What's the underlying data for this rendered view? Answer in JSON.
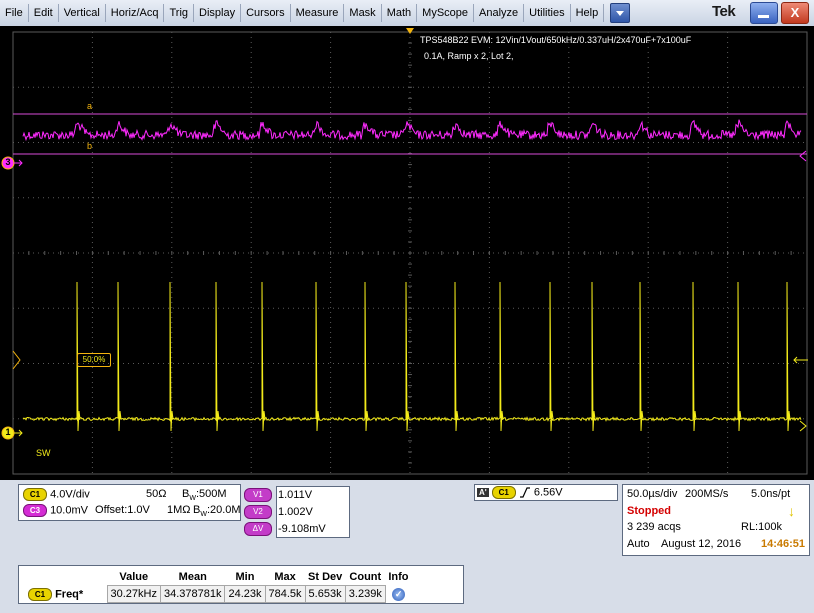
{
  "menubar": {
    "items": [
      "File",
      "Edit",
      "Vertical",
      "Horiz/Acq",
      "Trig",
      "Display",
      "Cursors",
      "Measure",
      "Mask",
      "Math",
      "MyScope",
      "Analyze",
      "Utilities",
      "Help"
    ],
    "brand": "Tek",
    "close_label": "X"
  },
  "screen": {
    "note_line1": "TPS548B22 EVM: 12Vin/1Vout/650kHz/0.337uH/2x470uF+7x100uF",
    "note_line2": "0.1A, Ramp x 2, Lot 2,",
    "cursor_a_label": "a",
    "cursor_b_label": "b",
    "ch3_marker": "3",
    "ch1_marker": "1",
    "trigger_level_label": "50.0%",
    "ch1_name": "SW",
    "colors": {
      "ch1": "#f2ea1a",
      "ch3": "#ff2bff",
      "grid": "#5a5a5a",
      "cursor": "#d94cd9",
      "marker": "#f5b50f"
    }
  },
  "channels": {
    "c1": {
      "badge": "C1",
      "scale": "4.0V/div",
      "impedance": "50Ω",
      "bw_prefix": "B",
      "bw_sub": "W",
      "bw_value": ":500M"
    },
    "c3": {
      "badge": "C3",
      "scale": "10.0mV",
      "offset": "Offset:1.0V",
      "impedance": "1MΩ",
      "bw_prefix": "B",
      "bw_sub": "W",
      "bw_value": ":20.0M"
    }
  },
  "cursors": {
    "v1_label": "V1",
    "v1_value": "1.011V",
    "v2_label": "V2",
    "v2_value": "1.002V",
    "dv_label": "ΔV",
    "dv_value": "-9.108mV"
  },
  "trigger": {
    "mode_badge": "A'",
    "source_badge": "C1",
    "slope_icon": "rising-edge",
    "level": "6.56V"
  },
  "acquisition": {
    "timebase": "50.0µs/div",
    "sample_rate": "200MS/s",
    "resolution": "5.0ns/pt",
    "state": "Stopped",
    "acqs": "3 239 acqs",
    "record_length": "RL:100k",
    "mode": "Auto",
    "date": "August 12, 2016",
    "time": "14:46:51",
    "state_color": "#d40000",
    "time_color": "#c97a00"
  },
  "measurements": {
    "headers": [
      "Value",
      "Mean",
      "Min",
      "Max",
      "St Dev",
      "Count",
      "Info"
    ],
    "rows": [
      {
        "badge": "C1",
        "name": "Freq*",
        "cells": [
          "30.27kHz",
          "34.378781k",
          "24.23k",
          "784.5k",
          "5.653k",
          "3.239k"
        ]
      }
    ]
  }
}
